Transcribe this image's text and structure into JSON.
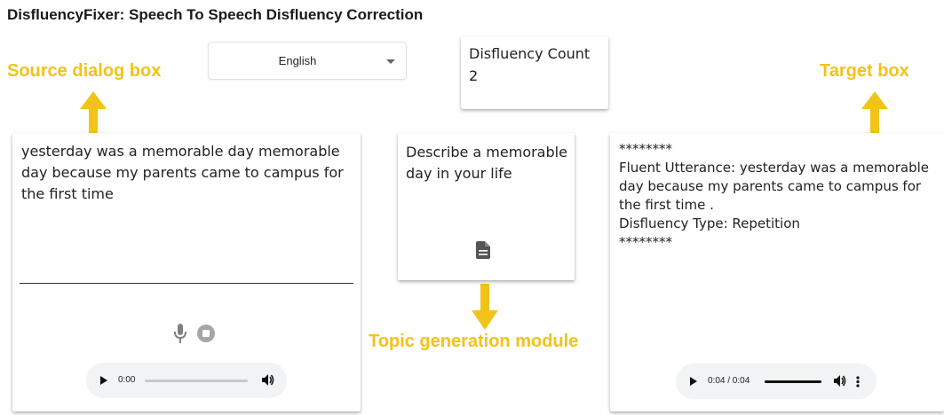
{
  "app": {
    "title": "DisfluencyFixer: Speech To Speech Disfluency Correction"
  },
  "annotations": {
    "source": "Source dialog box",
    "target": "Target box",
    "topic": "Topic generation module"
  },
  "language_select": {
    "value": "English"
  },
  "disfluency_count": {
    "label": "Disfluency Count",
    "value": "2"
  },
  "source": {
    "text": "yesterday was a memorable day memorable day because my parents came to campus for the first time",
    "audio": {
      "time": "0:00",
      "progress": 0
    }
  },
  "topic": {
    "text": "Describe a memorable day in your life"
  },
  "target": {
    "lines": [
      "********",
      "Fluent Utterance: yesterday was a memorable day because my parents came to campus for the first time .",
      "Disfluency Type: Repetition",
      "********"
    ],
    "audio": {
      "time": "0:04 / 0:04",
      "progress": 1
    }
  },
  "colors": {
    "annotation": "#f2c318",
    "audio_bg": "#f1f3f4"
  },
  "icons": [
    "chevron-down-icon",
    "mic-icon",
    "stop-icon",
    "play-icon",
    "volume-icon",
    "more-vert-icon",
    "document-icon",
    "arrow-up-icon",
    "arrow-down-icon"
  ]
}
